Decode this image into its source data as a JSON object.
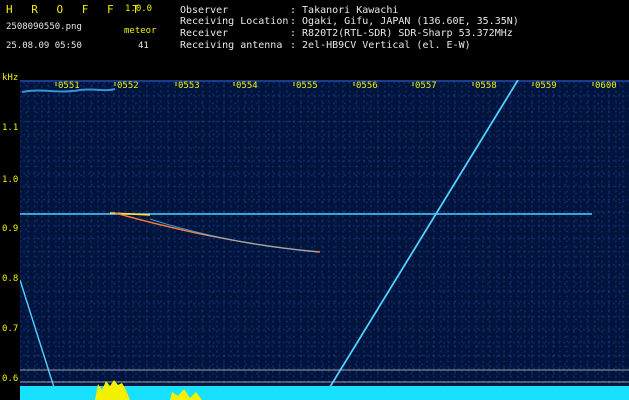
{
  "app": {
    "name": "H R O F F T",
    "version": "1.0.0"
  },
  "file": {
    "name": "2508090550.png",
    "datetime": "25.08.09 05:50"
  },
  "meteor": {
    "label": "meteor",
    "count": "41"
  },
  "station": {
    "observer_label": "Observer",
    "observer": ": Takanori Kawachi",
    "location_label": "Receiving Location",
    "location": ": Ogaki, Gifu, JAPAN (136.60E, 35.35N)",
    "receiver_label": "Receiver",
    "receiver": ": R820T2(RTL-SDR) SDR-Sharp 53.372MHz",
    "antenna_label": "Receiving antenna",
    "antenna": ": 2el-HB9CV Vertical (el. E-W)"
  },
  "axes": {
    "y_unit": "kHz",
    "y_ticks": [
      "1.1",
      "1.0",
      "0.9",
      "0.8",
      "0.7",
      "0.6"
    ],
    "x_ticks": [
      "0551",
      "0552",
      "0553",
      "0554",
      "0555",
      "0556",
      "0557",
      "0558",
      "0559",
      "0600"
    ]
  },
  "colors": {
    "label": "#f2f200",
    "text": "#e8e8e8",
    "background": "#00143c",
    "signal": "#4fd2ff",
    "trace": "#ffe23a"
  }
}
